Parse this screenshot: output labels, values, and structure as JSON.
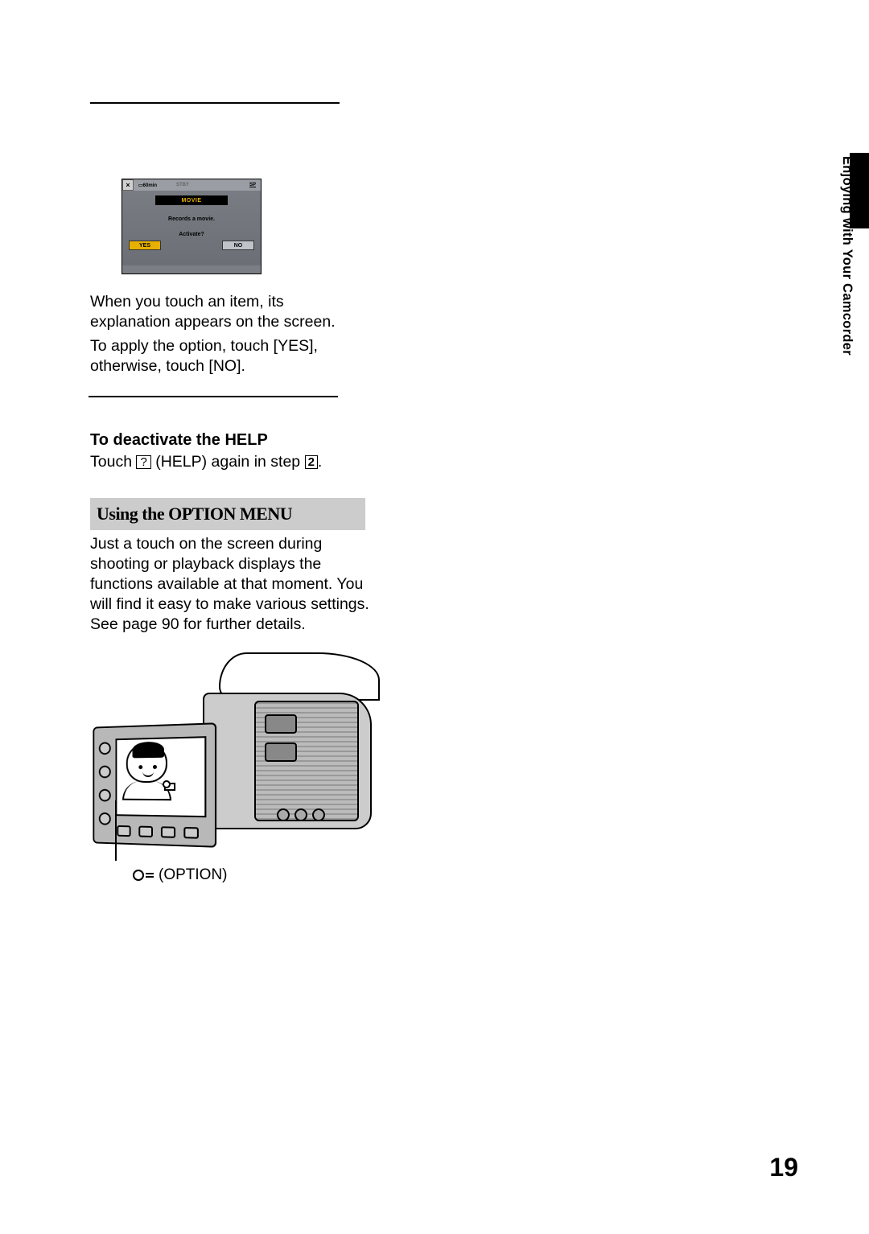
{
  "lcd": {
    "close_x": "×",
    "battery": "60min",
    "stby": "STBY",
    "sp": "SP",
    "movie_label": "MOVIE",
    "records": "Records a movie.",
    "activate": "Activate?",
    "yes": "YES",
    "no": "NO"
  },
  "para1": "When you touch an item, its explanation appears on the screen.",
  "para2": "To apply the option, touch [YES], otherwise, touch [NO].",
  "h3_deactivate": "To deactivate the HELP",
  "touch_text_a": "Touch ",
  "help_glyph": "?",
  "touch_text_b": " (HELP) again in step ",
  "step_no": "2",
  "touch_text_c": ".",
  "h2_option": "Using the OPTION MENU",
  "para_option": "Just a touch on the screen during shooting or playback displays the functions available at that moment. You will find it easy to make various settings. See page 90 for further details.",
  "option_label": "(OPTION)",
  "side_text": "Enjoying with Your Camcorder",
  "page_no": "19"
}
